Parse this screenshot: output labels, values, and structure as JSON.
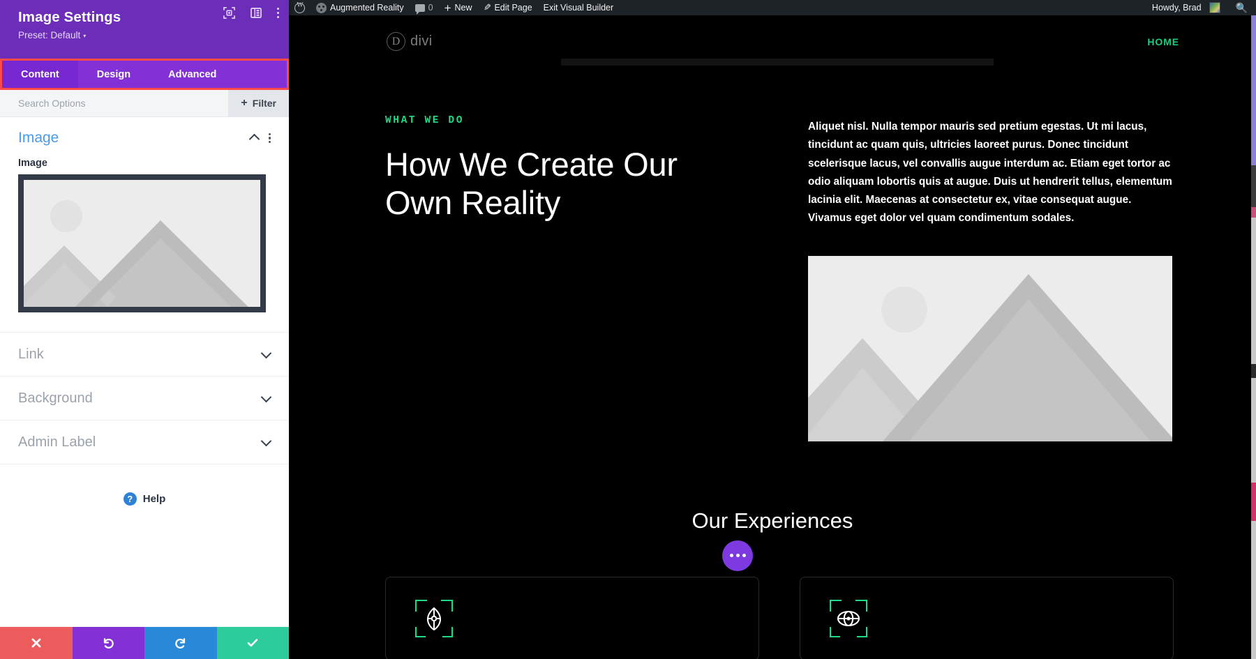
{
  "adminbar": {
    "wp_logo_icon": "wordpress-logo-icon",
    "site_icon": "site-dashboard-icon",
    "site_name": "Augmented Reality",
    "comments_icon": "comment-bubble-icon",
    "comments_count": "0",
    "new_icon": "plus-icon",
    "new_label": "New",
    "edit_icon": "pencil-icon",
    "edit_label": "Edit Page",
    "exit_label": "Exit Visual Builder",
    "howdy": "Howdy, Brad",
    "avatar_icon": "user-avatar",
    "search_icon": "search-icon"
  },
  "sidebar": {
    "title": "Image Settings",
    "preset_label": "Preset: Default",
    "preset_caret": "▾",
    "header_icons": [
      {
        "name": "focus-target-icon",
        "glyph": "⬚"
      },
      {
        "name": "layout-panel-icon",
        "glyph": "▥"
      },
      {
        "name": "kebab-menu-icon",
        "glyph": "⋮"
      }
    ],
    "tabs": [
      {
        "label": "Content",
        "active": true
      },
      {
        "label": "Design",
        "active": false
      },
      {
        "label": "Advanced",
        "active": false
      }
    ],
    "highlight_color": "#ff4a4a",
    "search": {
      "value": "",
      "placeholder": "Search Options"
    },
    "filter_button": {
      "label": "Filter",
      "plus": "+"
    },
    "open_section": {
      "title": "Image",
      "collapse_icon": "chevron-up-icon",
      "options_icon": "kebab-menu-icon",
      "field_label": "Image",
      "upload_preview_icon": "image-placeholder-thumbnail"
    },
    "closed_sections": [
      {
        "title": "Link",
        "icon": "chevron-down-icon"
      },
      {
        "title": "Background",
        "icon": "chevron-down-icon"
      },
      {
        "title": "Admin Label",
        "icon": "chevron-down-icon"
      }
    ],
    "help": {
      "badge": "?",
      "label": "Help"
    },
    "footer_buttons": [
      {
        "name": "cancel-button",
        "glyph": "✖",
        "color": "#ec5c5c"
      },
      {
        "name": "undo-button",
        "glyph": "↺",
        "color": "#8331d6"
      },
      {
        "name": "redo-button",
        "glyph": "↻",
        "color": "#2a88d8"
      },
      {
        "name": "save-button",
        "glyph": "✔",
        "color": "#2ecc9d"
      }
    ]
  },
  "preview": {
    "logo_mark": "D",
    "logo_word": "divi",
    "nav": [
      {
        "label": "HOME",
        "color": "#12d37e"
      }
    ],
    "hero": {
      "eyebrow": "WHAT WE DO",
      "heading": "How We Create Our Own Reality",
      "paragraph": "Aliquet nisl. Nulla tempor mauris sed pretium egestas. Ut mi lacus, tincidunt ac quam quis, ultricies laoreet purus. Donec tincidunt scelerisque lacus, vel convallis augue interdum ac. Etiam eget tortor ac odio aliquam lobortis quis at augue. Duis ut hendrerit tellus, elementum lacinia elit. Maecenas at consectetur ex, vitae consequat augue. Vivamus eget dolor vel quam condimentum sodales.",
      "image_icon": "image-placeholder"
    },
    "experiences": {
      "title": "Our Experiences",
      "cards": [
        {
          "icon": "vr-compass-icon"
        },
        {
          "icon": "ar-globe-icon"
        }
      ]
    },
    "module_menu": {
      "name": "module-options-dots",
      "color": "#7d3ae0"
    }
  }
}
